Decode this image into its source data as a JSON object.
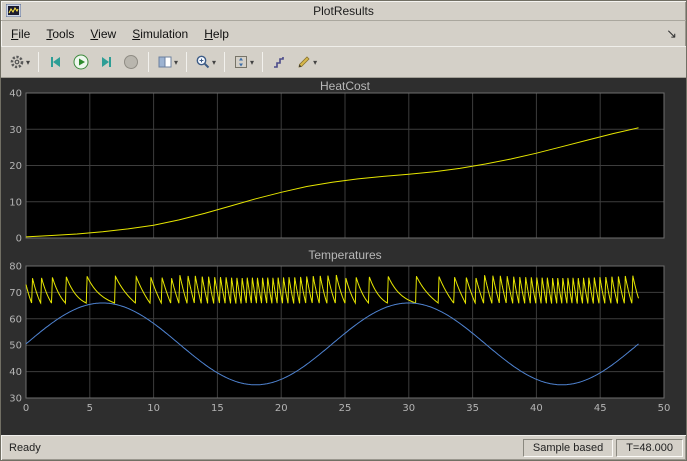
{
  "window": {
    "title": "PlotResults"
  },
  "menu": {
    "items": [
      {
        "label": "File"
      },
      {
        "label": "Tools"
      },
      {
        "label": "View"
      },
      {
        "label": "Simulation"
      },
      {
        "label": "Help"
      }
    ],
    "dock_icon": "↘"
  },
  "toolbar": {
    "items": [
      {
        "name": "settings",
        "icon": "gear",
        "dropdown": true
      },
      {
        "sep": true
      },
      {
        "name": "step-back",
        "icon": "step-back"
      },
      {
        "name": "run",
        "icon": "run"
      },
      {
        "name": "step-forward",
        "icon": "step-forward"
      },
      {
        "name": "stop",
        "icon": "stop"
      },
      {
        "sep": true
      },
      {
        "name": "layout",
        "icon": "layout",
        "dropdown": true
      },
      {
        "sep": true
      },
      {
        "name": "zoom",
        "icon": "zoom",
        "dropdown": true
      },
      {
        "sep": true
      },
      {
        "name": "fit-to-view",
        "icon": "fit",
        "dropdown": true
      },
      {
        "sep": true
      },
      {
        "name": "signal-stairs",
        "icon": "stairs"
      },
      {
        "name": "measurements",
        "icon": "measure",
        "dropdown": true
      }
    ]
  },
  "status": {
    "left": "Ready",
    "sample_mode": "Sample based",
    "time": "T=48.000"
  },
  "colors": {
    "chrome": "#d4d0c8",
    "panel": "#2e2e2e",
    "plot_bg": "#000000",
    "grid": "#3d3d3d",
    "axis_border": "#6e6e6e",
    "tick_text": "#b4b4b4",
    "yellow_series": "#e6e600",
    "blue_series": "#4f83d1"
  },
  "chart_data": [
    {
      "type": "line",
      "title": "HeatCost",
      "xlim": [
        0,
        50
      ],
      "ylim": [
        0,
        40
      ],
      "xticks": [
        0,
        5,
        10,
        15,
        20,
        25,
        30,
        35,
        40,
        45,
        50
      ],
      "yticks": [
        0,
        10,
        20,
        30,
        40
      ],
      "show_x_tick_labels": false,
      "series": [
        {
          "name": "heat-cost",
          "color": "#e6e600",
          "x": [
            0,
            2,
            4,
            6,
            8,
            10,
            12,
            14,
            16,
            18,
            20,
            22,
            24,
            26,
            28,
            30,
            32,
            34,
            36,
            38,
            40,
            42,
            44,
            46,
            48
          ],
          "y": [
            0.3,
            0.7,
            1.1,
            1.7,
            2.5,
            3.5,
            5.0,
            6.8,
            8.8,
            10.8,
            12.6,
            14.2,
            15.4,
            16.3,
            17.0,
            17.6,
            18.3,
            19.2,
            20.4,
            21.8,
            23.4,
            25.2,
            27.0,
            28.8,
            30.4
          ]
        }
      ]
    },
    {
      "type": "line",
      "title": "Temperatures",
      "xlim": [
        0,
        50
      ],
      "ylim": [
        30,
        80
      ],
      "xticks": [
        0,
        5,
        10,
        15,
        20,
        25,
        30,
        35,
        40,
        45,
        50
      ],
      "yticks": [
        30,
        40,
        50,
        60,
        70,
        80
      ],
      "show_x_tick_labels": true,
      "series": [
        {
          "name": "indoor-temperature",
          "color": "#e6e600",
          "generator": "thermostat",
          "params": {
            "t_end": 48,
            "dt": 0.01,
            "initial_temp": 73,
            "on_below": 66,
            "off_above": 75.3,
            "heat_rate": 150,
            "cool_coeff": 0.8,
            "loss_offset": 2,
            "outdoor_mean": 50.5,
            "outdoor_amplitude": 15.5,
            "outdoor_period": 24
          }
        },
        {
          "name": "outdoor-temperature",
          "color": "#4f83d1",
          "generator": "sine",
          "params": {
            "mean": 50.5,
            "amplitude": 15.5,
            "period": 24,
            "t_end": 48,
            "step": 0.1
          }
        }
      ]
    }
  ]
}
